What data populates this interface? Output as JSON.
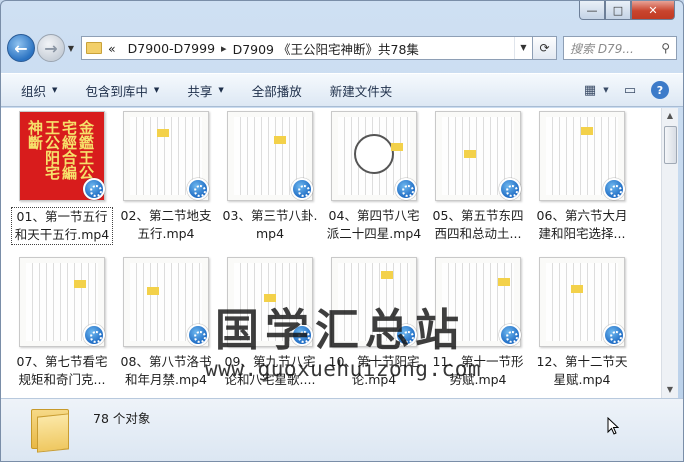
{
  "window": {
    "caption": {
      "minimize": "—",
      "maximize": "□",
      "close": "✕"
    }
  },
  "nav": {
    "back_icon": "←",
    "forward_icon": "→",
    "breadcrumb": [
      "D7900-D7999",
      "D7909 《王公阳宅神断》共78集"
    ],
    "overflow_marker": "«",
    "search_placeholder": "搜索 D79..."
  },
  "toolbar": {
    "organize": "组织",
    "include_library": "包含到库中",
    "share": "共享",
    "play_all": "全部播放",
    "new_folder": "新建文件夹"
  },
  "files": [
    {
      "label1": "01、第一节五行",
      "label2": "和天干五行.mp4",
      "thumb": "red",
      "selected": true
    },
    {
      "label1": "02、第二节地支",
      "label2": "五行.mp4",
      "thumb": "page",
      "selected": false
    },
    {
      "label1": "03、第三节八卦.",
      "label2": "mp4",
      "thumb": "page",
      "selected": false
    },
    {
      "label1": "04、第四节八宅",
      "label2": "派二十四星.mp4",
      "thumb": "diagram",
      "selected": false
    },
    {
      "label1": "05、第五节东四",
      "label2": "西四和总动土...",
      "thumb": "page",
      "selected": false
    },
    {
      "label1": "06、第六节大月",
      "label2": "建和阳宅选择...",
      "thumb": "page",
      "selected": false
    },
    {
      "label1": "07、第七节看宅",
      "label2": "规矩和奇门克...",
      "thumb": "page",
      "selected": false
    },
    {
      "label1": "08、第八节洛书",
      "label2": "和年月禁.mp4",
      "thumb": "page",
      "selected": false
    },
    {
      "label1": "09、第九节八宅",
      "label2": "论和八宅星歌....",
      "thumb": "page",
      "selected": false
    },
    {
      "label1": "10、第十节阳宅",
      "label2": "论.mp4",
      "thumb": "page",
      "selected": false
    },
    {
      "label1": "11、第十一节形",
      "label2": "势赋.mp4",
      "thumb": "page",
      "selected": false
    },
    {
      "label1": "12、第十二节天",
      "label2": "星赋.mp4",
      "thumb": "page",
      "selected": false
    }
  ],
  "red_cover_text": "金鑑王公宅經合編 王公阳宅神斷",
  "watermark": {
    "title": "国学汇总站",
    "url": "www.guoxuehuizong.com"
  },
  "status": {
    "count": "78 个对象"
  },
  "colors": {
    "accent": "#2b73c2",
    "close": "#c9452e",
    "folder": "#f2cf6a"
  }
}
